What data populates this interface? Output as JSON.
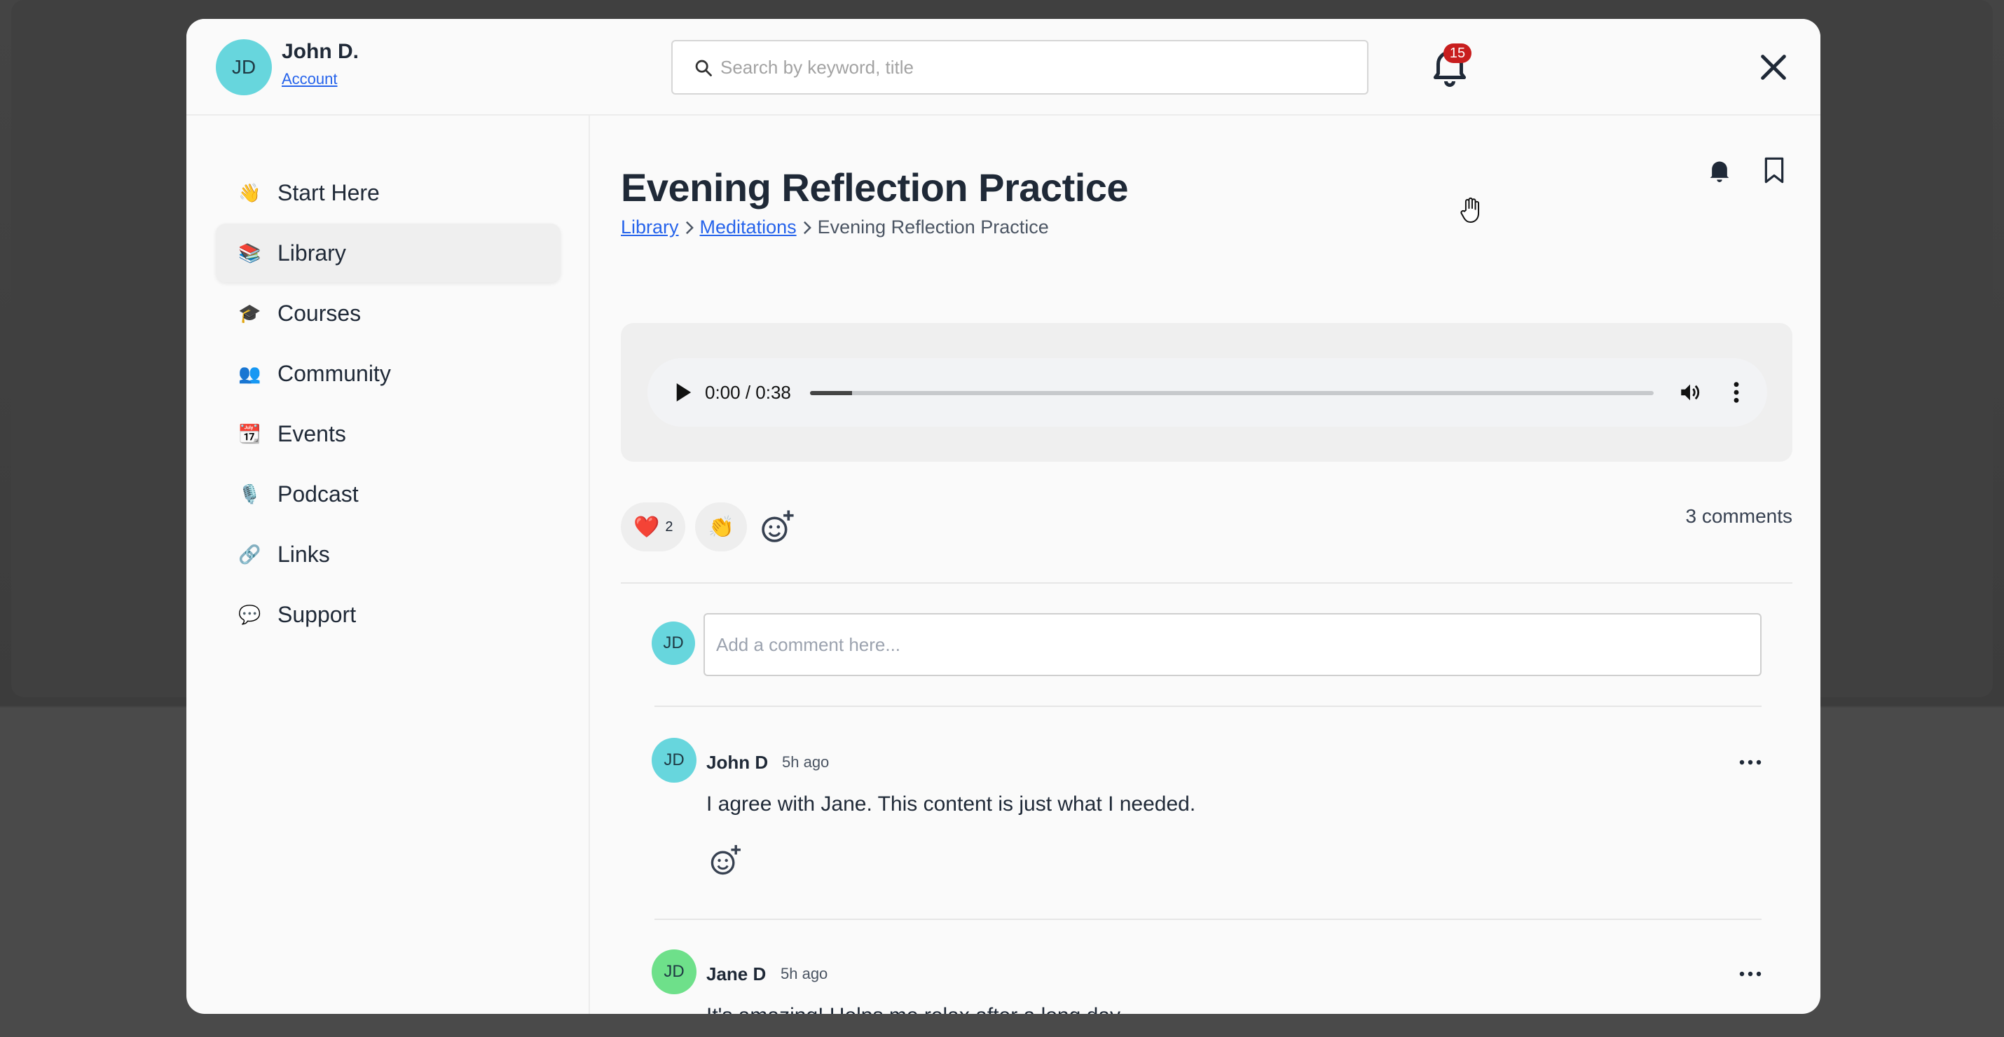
{
  "header": {
    "avatar_initials": "JD",
    "user_name": "John D.",
    "account_link": "Account",
    "search_placeholder": "Search by keyword, title",
    "notification_count": "15"
  },
  "sidebar": {
    "items": [
      {
        "emoji": "👋",
        "label": "Start Here",
        "active": false
      },
      {
        "emoji": "📚",
        "label": "Library",
        "active": true
      },
      {
        "emoji": "🎓",
        "label": "Courses",
        "active": false
      },
      {
        "emoji": "👥",
        "label": "Community",
        "active": false
      },
      {
        "emoji": "📆",
        "label": "Events",
        "active": false
      },
      {
        "emoji": "🎙️",
        "label": "Podcast",
        "active": false
      },
      {
        "emoji": "🔗",
        "label": "Links",
        "active": false
      },
      {
        "emoji": "💬",
        "label": "Support",
        "active": false
      }
    ]
  },
  "main": {
    "title": "Evening Reflection Practice",
    "breadcrumb": {
      "library": "Library",
      "meditations": "Meditations",
      "current": "Evening Reflection Practice"
    },
    "audio": {
      "time": "0:00 / 0:38",
      "progress": 0.05
    },
    "reactions": [
      {
        "emoji": "❤️",
        "count": "2"
      },
      {
        "emoji": "👏",
        "count": ""
      }
    ],
    "comment_count": "3 comments",
    "composer": {
      "avatar_initials": "JD",
      "placeholder": "Add a comment here..."
    },
    "comments": [
      {
        "initials": "JD",
        "name": "John D",
        "time": "5h ago",
        "text": "I agree with Jane. This content is just what I needed.",
        "avatar_color": "#67d6dd"
      },
      {
        "initials": "JD",
        "name": "Jane D",
        "time": "5h ago",
        "text": "It's amazing! Helps me relax after a long day.",
        "avatar_color": "#6ee08a"
      }
    ]
  },
  "colors": {
    "avatar_teal": "#67d6dd",
    "avatar_green": "#6ee08a",
    "link_blue": "#2563eb",
    "badge_red": "#c81e1e"
  }
}
